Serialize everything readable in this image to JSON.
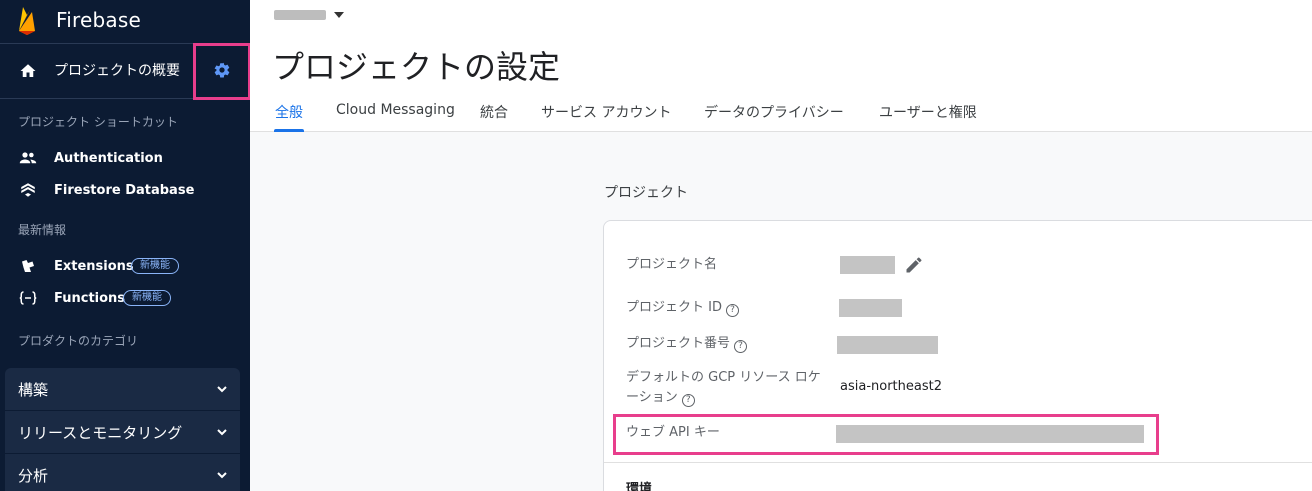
{
  "app": {
    "name": "Firebase"
  },
  "sidebar": {
    "overview_label": "プロジェクトの概要",
    "shortcuts_heading": "プロジェクト ショートカット",
    "shortcuts": [
      {
        "label": "Authentication",
        "icon": "people-icon"
      },
      {
        "label": "Firestore Database",
        "icon": "firestore-icon"
      }
    ],
    "latest_heading": "最新情報",
    "latest": [
      {
        "label": "Extensions",
        "icon": "extensions-icon",
        "badge": "新機能"
      },
      {
        "label": "Functions",
        "icon": "functions-icon",
        "badge": "新機能"
      }
    ],
    "categories_heading": "プロダクトのカテゴリ",
    "categories": [
      {
        "label": "構築"
      },
      {
        "label": "リリースとモニタリング"
      },
      {
        "label": "分析"
      }
    ]
  },
  "main": {
    "page_title": "プロジェクトの設定",
    "tabs": [
      {
        "label": "全般",
        "active": true
      },
      {
        "label": "Cloud Messaging"
      },
      {
        "label": "統合"
      },
      {
        "label": "サービス アカウント"
      },
      {
        "label": "データのプライバシー"
      },
      {
        "label": "ユーザーと権限"
      }
    ],
    "project_section": {
      "heading": "プロジェクト",
      "rows": [
        {
          "label": "プロジェクト名"
        },
        {
          "label": "プロジェクト ID"
        },
        {
          "label": "プロジェクト番号"
        },
        {
          "label_line1": "デフォルトの GCP リソース ロケ",
          "label_line2": "ーション",
          "value": "asia-northeast2"
        },
        {
          "label": "ウェブ API キー"
        }
      ],
      "help_glyph": "?"
    },
    "environment_heading": "環境"
  },
  "colors": {
    "sidebar_bg": "#0c1b33",
    "accent": "#1a73e8",
    "highlight": "#e83e8c",
    "firebase_orange": "#ffa000"
  }
}
